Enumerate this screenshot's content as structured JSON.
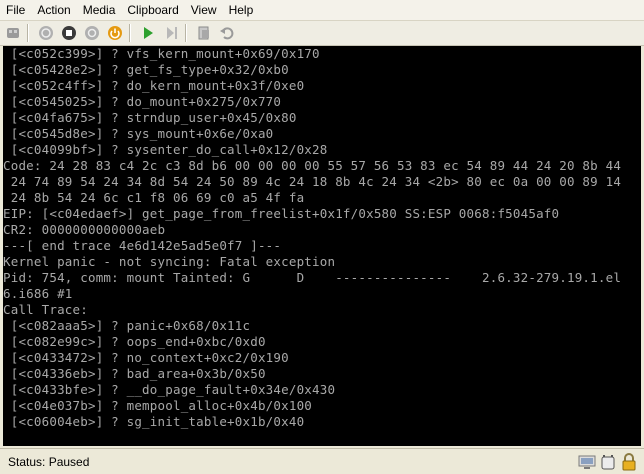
{
  "menu": [
    "File",
    "Action",
    "Media",
    "Clipboard",
    "View",
    "Help"
  ],
  "toolbar": {
    "icons": [
      "ctrl-alt-del-icon",
      "start-icon",
      "turn-off-icon",
      "shutdown-icon",
      "power-icon",
      "play-icon",
      "pause-icon",
      "snapshot-icon",
      "revert-icon"
    ]
  },
  "console": {
    "lines": [
      " [<c052c399>] ? vfs_kern_mount+0x69/0x170",
      " [<c05428e2>] ? get_fs_type+0x32/0xb0",
      " [<c052c4ff>] ? do_kern_mount+0x3f/0xe0",
      " [<c0545025>] ? do_mount+0x275/0x770",
      " [<c04fa675>] ? strndup_user+0x45/0x80",
      " [<c0545d8e>] ? sys_mount+0x6e/0xa0",
      " [<c04099bf>] ? sysenter_do_call+0x12/0x28",
      "Code: 24 28 83 c4 2c c3 8d b6 00 00 00 00 55 57 56 53 83 ec 54 89 44 24 20 8b 44",
      " 24 74 89 54 24 34 8d 54 24 50 89 4c 24 18 8b 4c 24 34 <2b> 80 ec 0a 00 00 89 14",
      " 24 8b 54 24 6c c1 f8 06 69 c0 a5 4f fa",
      "EIP: [<c04edaef>] get_page_from_freelist+0x1f/0x580 SS:ESP 0068:f5045af0",
      "CR2: 0000000000000aeb",
      "---[ end trace 4e6d142e5ad5e0f7 ]---",
      "Kernel panic - not syncing: Fatal exception",
      "Pid: 754, comm: mount Tainted: G      D    ---------------    2.6.32-279.19.1.el",
      "6.i686 #1",
      "Call Trace:",
      " [<c082aaa5>] ? panic+0x68/0x11c",
      " [<c082e99c>] ? oops_end+0xbc/0xd0",
      " [<c0433472>] ? no_context+0xc2/0x190",
      " [<c04336eb>] ? bad_area+0x3b/0x50",
      " [<c0433bfe>] ? __do_page_fault+0x34e/0x430",
      " [<c04e037b>] ? mempool_alloc+0x4b/0x100",
      " [<c06004eb>] ? sg_init_table+0x1b/0x40"
    ]
  },
  "status": {
    "text": "Status: Paused",
    "icons": [
      "display-icon",
      "keyboard-icon",
      "lock-icon"
    ]
  }
}
